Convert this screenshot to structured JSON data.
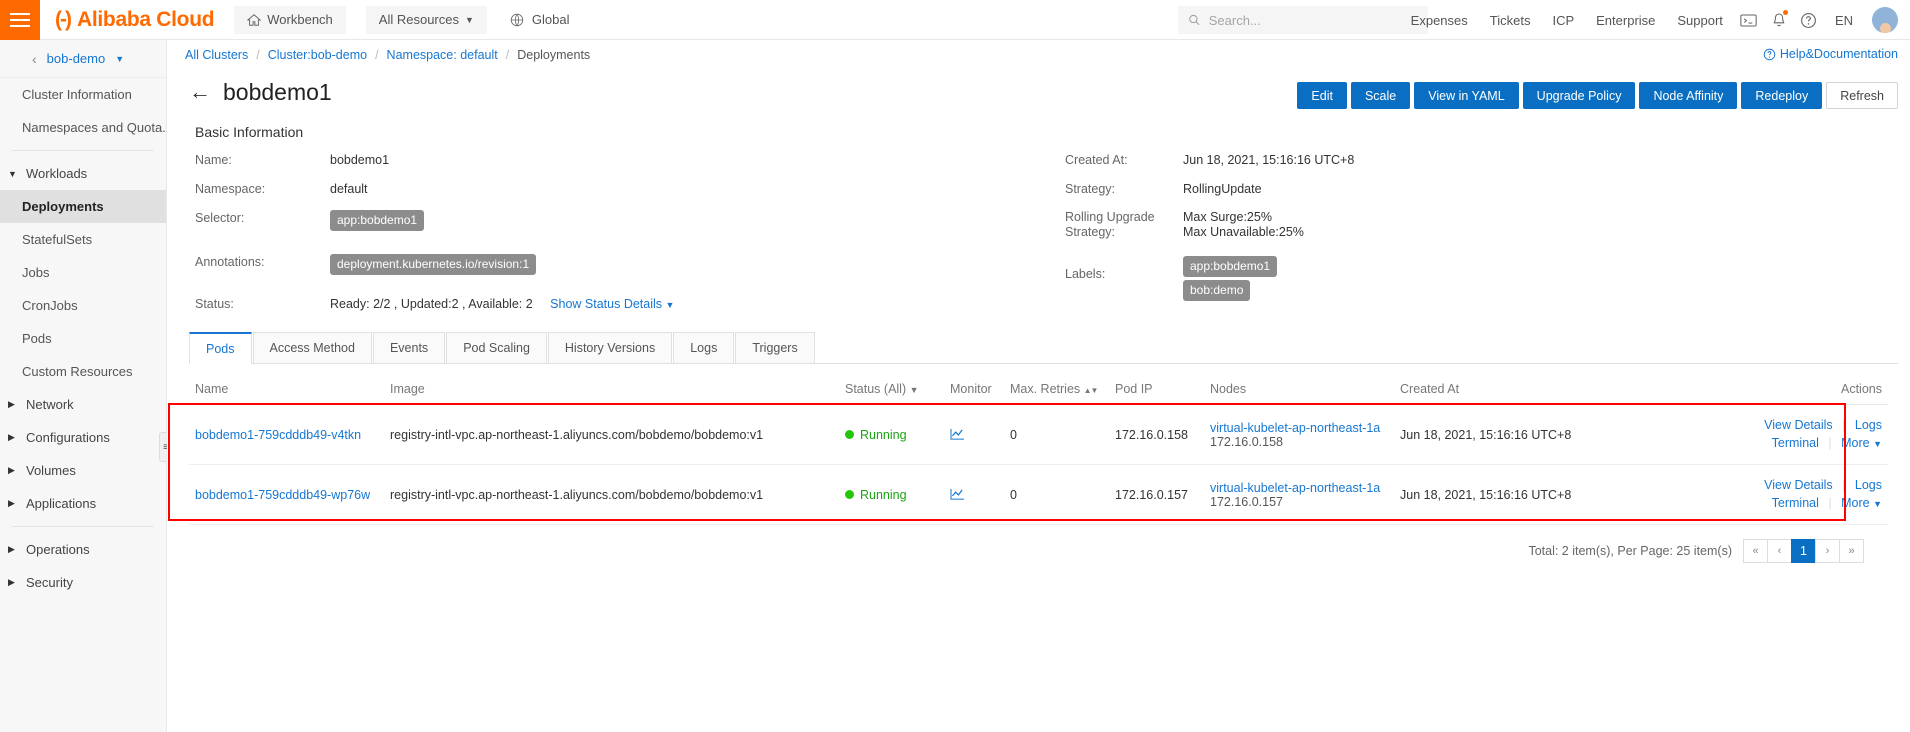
{
  "topnav": {
    "menu_icon": "hamburger-icon",
    "brand": "Alibaba Cloud",
    "brand_mark": "(-)",
    "workbench": "Workbench",
    "all_resources": "All Resources",
    "global": "Global",
    "search_placeholder": "Search...",
    "links": [
      "Expenses",
      "Tickets",
      "ICP",
      "Enterprise",
      "Support"
    ],
    "lang": "EN",
    "icons": [
      "cloudshell-icon",
      "bell-icon",
      "help-circle-icon"
    ]
  },
  "sidebar": {
    "cluster": "bob-demo",
    "items": [
      {
        "label": "Cluster Information",
        "type": "item",
        "active": false
      },
      {
        "label": "Namespaces and Quota...",
        "type": "item",
        "active": false
      },
      {
        "label": "Workloads",
        "type": "group-open"
      },
      {
        "label": "Deployments",
        "type": "item",
        "active": true
      },
      {
        "label": "StatefulSets",
        "type": "item",
        "active": false
      },
      {
        "label": "Jobs",
        "type": "item",
        "active": false
      },
      {
        "label": "CronJobs",
        "type": "item",
        "active": false
      },
      {
        "label": "Pods",
        "type": "item",
        "active": false
      },
      {
        "label": "Custom Resources",
        "type": "item",
        "active": false
      },
      {
        "label": "Network",
        "type": "group"
      },
      {
        "label": "Configurations",
        "type": "group"
      },
      {
        "label": "Volumes",
        "type": "group"
      },
      {
        "label": "Applications",
        "type": "group"
      },
      {
        "label": "Operations",
        "type": "group"
      },
      {
        "label": "Security",
        "type": "group"
      }
    ]
  },
  "breadcrumb": {
    "items": [
      "All Clusters",
      "Cluster:bob-demo",
      "Namespace: default",
      "Deployments"
    ],
    "help": "Help&Documentation"
  },
  "page": {
    "title": "bobdemo1",
    "actions": [
      {
        "label": "Edit",
        "style": "primary"
      },
      {
        "label": "Scale",
        "style": "primary"
      },
      {
        "label": "View in YAML",
        "style": "primary"
      },
      {
        "label": "Upgrade Policy",
        "style": "primary"
      },
      {
        "label": "Node Affinity",
        "style": "primary"
      },
      {
        "label": "Redeploy",
        "style": "primary"
      },
      {
        "label": "Refresh",
        "style": "ghost"
      }
    ]
  },
  "basic_info": {
    "section_title": "Basic Information",
    "left": {
      "name_label": "Name:",
      "name_value": "bobdemo1",
      "namespace_label": "Namespace:",
      "namespace_value": "default",
      "selector_label": "Selector:",
      "selector_tag": "app:bobdemo1",
      "annotations_label": "Annotations:",
      "annotations_tag": "deployment.kubernetes.io/revision:1",
      "status_label": "Status:",
      "status_value": "Ready: 2/2 ,  Updated:2 ,  Available: 2",
      "status_details_link": "Show Status Details"
    },
    "right": {
      "created_label": "Created At:",
      "created_value": "Jun 18, 2021, 15:16:16 UTC+8",
      "strategy_label": "Strategy:",
      "strategy_value": "RollingUpdate",
      "rolling_label": "Rolling Upgrade Strategy:",
      "rolling_value_1": "Max Surge:25%",
      "rolling_value_2": "Max Unavailable:25%",
      "labels_label": "Labels:",
      "labels_tags": [
        "app:bobdemo1",
        "bob:demo"
      ]
    }
  },
  "tabs": [
    {
      "label": "Pods",
      "active": true
    },
    {
      "label": "Access Method",
      "active": false
    },
    {
      "label": "Events",
      "active": false
    },
    {
      "label": "Pod Scaling",
      "active": false
    },
    {
      "label": "History Versions",
      "active": false
    },
    {
      "label": "Logs",
      "active": false
    },
    {
      "label": "Triggers",
      "active": false
    }
  ],
  "table": {
    "columns": [
      "Name",
      "Image",
      "Status (All)",
      "Monitor",
      "Max. Retries",
      "Pod IP",
      "Nodes",
      "Created At",
      "Actions"
    ],
    "rows": [
      {
        "name": "bobdemo1-759cdddb49-v4tkn",
        "image": "registry-intl-vpc.ap-northeast-1.aliyuncs.com/bobdemo/bobdemo:v1",
        "status": "Running",
        "monitor": "chart-line-icon",
        "retries": "0",
        "pod_ip": "172.16.0.158",
        "node_name": "virtual-kubelet-ap-northeast-1a",
        "node_ip": "172.16.0.158",
        "created_at": "Jun 18, 2021, 15:16:16 UTC+8",
        "actions": [
          "View Details",
          "Logs",
          "Terminal",
          "More"
        ]
      },
      {
        "name": "bobdemo1-759cdddb49-wp76w",
        "image": "registry-intl-vpc.ap-northeast-1.aliyuncs.com/bobdemo/bobdemo:v1",
        "status": "Running",
        "monitor": "chart-line-icon",
        "retries": "0",
        "pod_ip": "172.16.0.157",
        "node_name": "virtual-kubelet-ap-northeast-1a",
        "node_ip": "172.16.0.157",
        "created_at": "Jun 18, 2021, 15:16:16 UTC+8",
        "actions": [
          "View Details",
          "Logs",
          "Terminal",
          "More"
        ]
      }
    ],
    "footer_summary": "Total: 2 item(s), Per Page: 25 item(s)",
    "pager": {
      "first": "«",
      "prev": "‹",
      "current": "1",
      "next": "›",
      "last": "»"
    }
  },
  "annotation": {
    "highlight_color": "#ff0000"
  }
}
